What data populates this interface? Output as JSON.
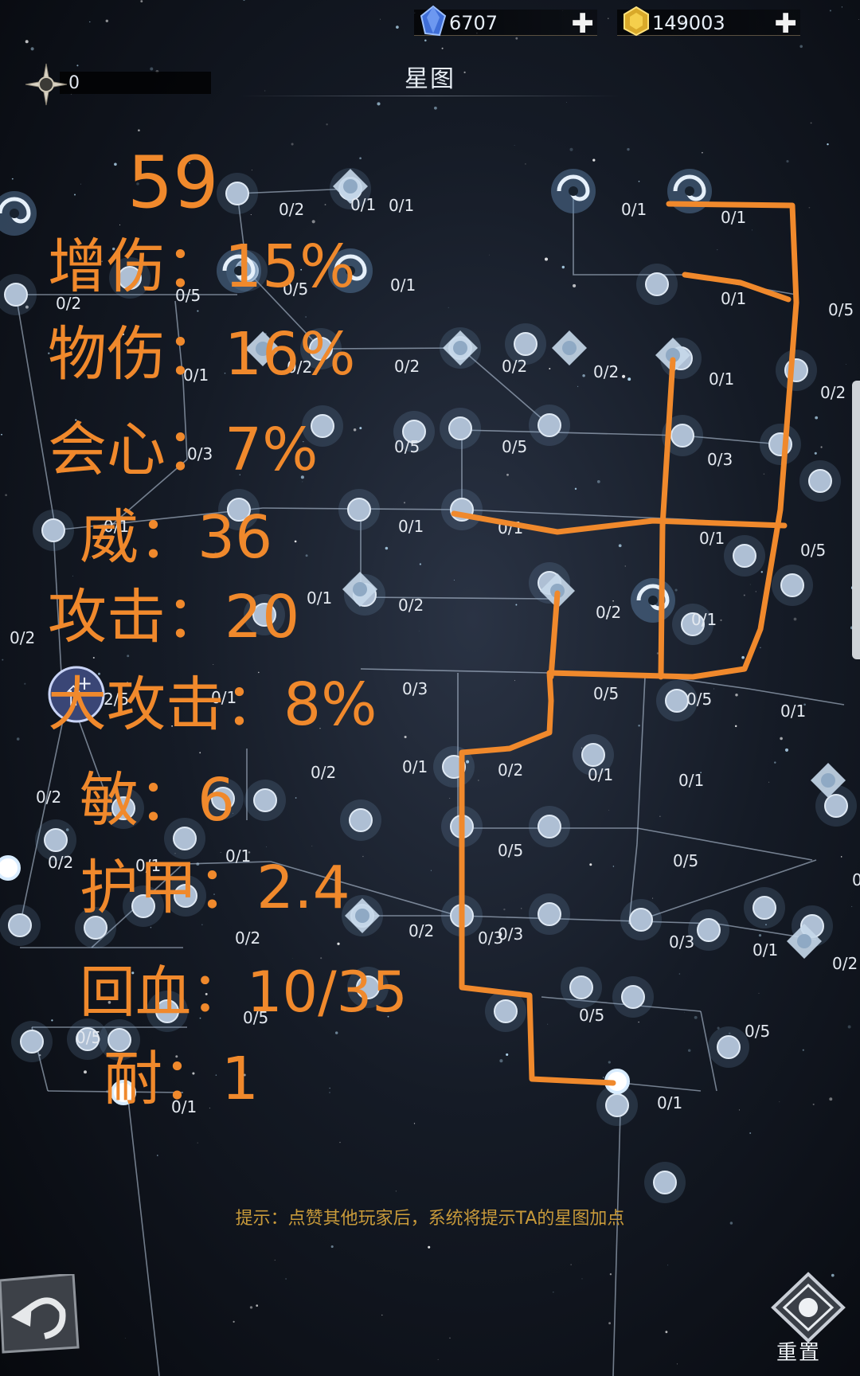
{
  "top_bar": {
    "gems": {
      "icon": "blue-crystal-icon",
      "value": "6707",
      "add_label": "✚"
    },
    "gold": {
      "icon": "gold-coin-icon",
      "value": "149003",
      "add_label": "✚"
    }
  },
  "star_points": {
    "icon": "compass-star-icon",
    "value": "0"
  },
  "title": "星图",
  "nodes": [
    {
      "label": "0/1"
    },
    {
      "label": "0/2"
    },
    {
      "label": "0/1"
    },
    {
      "label": "0/1"
    },
    {
      "label": "0/1"
    },
    {
      "label": "0/2"
    },
    {
      "label": "0/5"
    },
    {
      "label": "0/5"
    },
    {
      "label": "0/1"
    },
    {
      "label": "0/1"
    },
    {
      "label": "0/5"
    },
    {
      "label": "0/1"
    },
    {
      "label": "0/2"
    },
    {
      "label": "0/2"
    },
    {
      "label": "0/2"
    },
    {
      "label": "0/2"
    },
    {
      "label": "0/1"
    },
    {
      "label": "0/2"
    },
    {
      "label": "0/3"
    },
    {
      "label": "0/5"
    },
    {
      "label": "0/5"
    },
    {
      "label": "0/3"
    },
    {
      "label": "0/1"
    },
    {
      "label": "0/1"
    },
    {
      "label": "0/1"
    },
    {
      "label": "0/1"
    },
    {
      "label": "0/5"
    },
    {
      "label": "0/2"
    },
    {
      "label": "0/1"
    },
    {
      "label": "0/2"
    },
    {
      "label": "0/2"
    },
    {
      "label": "0/1"
    },
    {
      "label": "0/3"
    },
    {
      "label": "0/5"
    },
    {
      "label": "0/5"
    },
    {
      "label": "0/1"
    },
    {
      "label": "0/1"
    },
    {
      "label": "0/2"
    },
    {
      "label": "0/2"
    },
    {
      "label": "0/1"
    },
    {
      "label": "0/2"
    },
    {
      "label": "0/1"
    },
    {
      "label": "0/1"
    },
    {
      "label": "0/2"
    },
    {
      "label": "0/1"
    },
    {
      "label": "0/1"
    },
    {
      "label": "0/5"
    },
    {
      "label": "0/5"
    },
    {
      "label": "0/1"
    },
    {
      "label": "0/2"
    },
    {
      "label": "0/3"
    },
    {
      "label": "0/2"
    },
    {
      "label": "0/3"
    },
    {
      "label": "0/3"
    },
    {
      "label": "0/1"
    },
    {
      "label": "0/2"
    },
    {
      "label": "0/5"
    },
    {
      "label": "0/5"
    },
    {
      "label": "0/5"
    },
    {
      "label": "0/5"
    },
    {
      "label": "0/1"
    },
    {
      "label": "0/1"
    },
    {
      "label": "2/5"
    }
  ],
  "handwritten_notes": [
    "59",
    "增伤：15%",
    "物伤：16%",
    "会心：7%",
    "威：36",
    "攻击：20",
    "大攻击：8%",
    "敏：6",
    "护甲：2.4",
    "回血：10/35",
    "耐：1"
  ],
  "hint": "提示：点赞其他玩家后，系统将提示TA的星图加点",
  "back_icon": "back-arrow-icon",
  "reset": {
    "icon": "reset-crystal-icon",
    "label": "重置"
  },
  "colors": {
    "annotation": "#f0892c",
    "hint": "#c89a3a",
    "node": "#aebfd4"
  }
}
